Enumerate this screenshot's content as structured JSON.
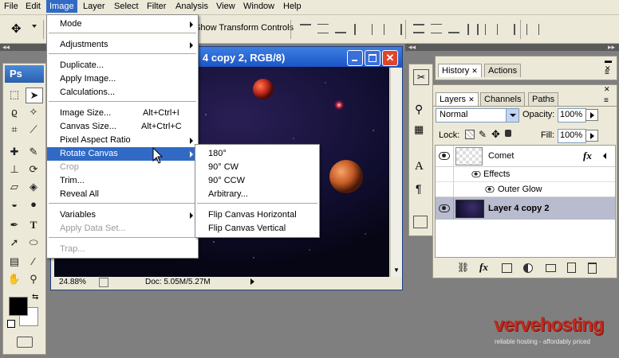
{
  "menubar": {
    "items": [
      "File",
      "Edit",
      "Image",
      "Layer",
      "Select",
      "Filter",
      "Analysis",
      "View",
      "Window",
      "Help"
    ],
    "active": "Image"
  },
  "optbar": {
    "show_transform": "Show Transform Controls"
  },
  "toolbox": {
    "logo": "Ps"
  },
  "document": {
    "title": "4 copy 2, RGB/8)",
    "zoom": "24.88%",
    "doc_size": "Doc: 5.05M/5.27M"
  },
  "image_menu": {
    "items": [
      {
        "label": "Mode",
        "submenu": true
      },
      {
        "label": "Adjustments",
        "submenu": true
      },
      {
        "label": "Duplicate..."
      },
      {
        "label": "Apply Image..."
      },
      {
        "label": "Calculations..."
      },
      {
        "label": "Image Size...",
        "shortcut": "Alt+Ctrl+I"
      },
      {
        "label": "Canvas Size...",
        "shortcut": "Alt+Ctrl+C"
      },
      {
        "label": "Pixel Aspect Ratio",
        "submenu": true
      },
      {
        "label": "Rotate Canvas",
        "submenu": true,
        "highlighted": true
      },
      {
        "label": "Crop",
        "disabled": true
      },
      {
        "label": "Trim..."
      },
      {
        "label": "Reveal All"
      },
      {
        "label": "Variables",
        "submenu": true
      },
      {
        "label": "Apply Data Set...",
        "disabled": true
      },
      {
        "label": "Trap...",
        "disabled": true
      }
    ]
  },
  "rotate_menu": {
    "items": [
      "180°",
      "90° CW",
      "90° CCW",
      "Arbitrary...",
      "Flip Canvas Horizontal",
      "Flip Canvas Vertical"
    ]
  },
  "history_panel": {
    "tabs": [
      "History",
      "Actions"
    ],
    "active": "History"
  },
  "layers_panel": {
    "tabs": [
      "Layers",
      "Channels",
      "Paths"
    ],
    "active": "Layers",
    "blend_mode": "Normal",
    "opacity_label": "Opacity:",
    "opacity": "100%",
    "lock_label": "Lock:",
    "fill_label": "Fill:",
    "fill": "100%",
    "layers": [
      {
        "name": "Comet",
        "fx": "fx"
      },
      {
        "effects_label": "Effects"
      },
      {
        "effect": "Outer Glow"
      },
      {
        "name": "Layer 4 copy 2",
        "selected": true
      }
    ]
  },
  "watermark": {
    "brand": "vervehosting",
    "tagline": "reliable hosting - affordably priced"
  },
  "colors": {
    "menu_highlight": "#316ac5",
    "chrome": "#ece9d8",
    "workspace": "#7f7f7f",
    "selected_layer": "#b8bcce",
    "brand_red": "#c22a1e"
  }
}
